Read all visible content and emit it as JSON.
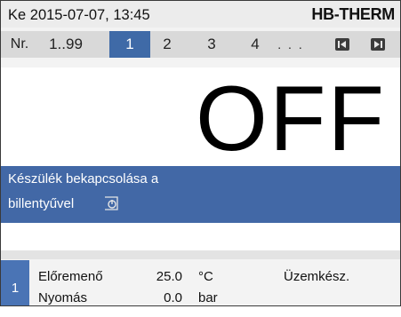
{
  "header": {
    "datetime": "Ke  2015-07-07, 13:45",
    "logo_text": "HB-THERM",
    "logo_color": "#2c63a8"
  },
  "tabs": {
    "nr_label": "Nr.",
    "range_label": "1..99",
    "items": [
      "1",
      "2",
      "3",
      "4"
    ],
    "active_index": 0,
    "ellipsis": ". . .",
    "prev_icon": "page-prev-icon",
    "next_icon": "page-next-icon",
    "active_color": "#3f6aa7"
  },
  "main": {
    "state": "OFF",
    "message_line1": "Készülék bekapcsolása a",
    "message_line2": "billentyűvel",
    "message_icon": "power-key-icon",
    "message_bg": "#4268a6"
  },
  "footer": {
    "unit_number": "1",
    "rows": [
      {
        "label": "Előremenő",
        "value": "25.0",
        "unit": "°C"
      },
      {
        "label": "Nyomás",
        "value": "0.0",
        "unit": "bar"
      }
    ],
    "status": "Üzemkész."
  }
}
